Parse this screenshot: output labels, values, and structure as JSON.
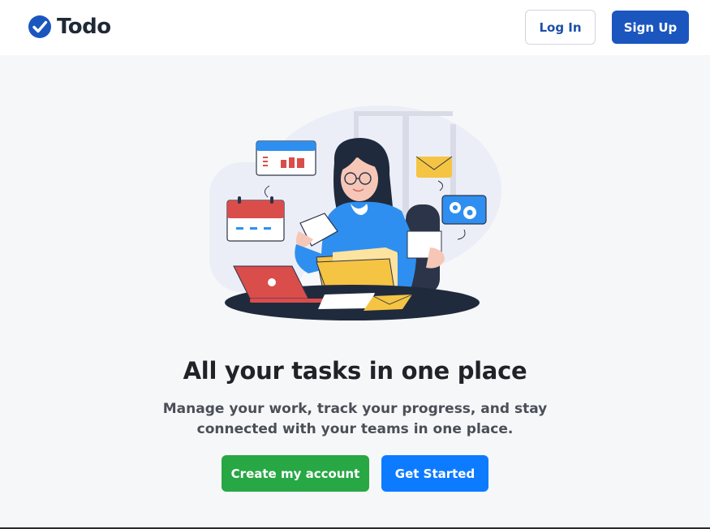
{
  "nav": {
    "brand_name": "Todo",
    "login_label": "Log In",
    "signup_label": "Sign Up"
  },
  "hero": {
    "headline": "All your tasks in one place",
    "subtext": "Manage your work, track your progress, and stay connected with your teams in one place.",
    "create_account_label": "Create my account",
    "get_started_label": "Get Started"
  },
  "colors": {
    "brand_blue": "#1b56bf",
    "accent_green": "#28a745",
    "accent_blue": "#0d7bff"
  },
  "icons": {
    "brand": "check-circle-icon"
  }
}
